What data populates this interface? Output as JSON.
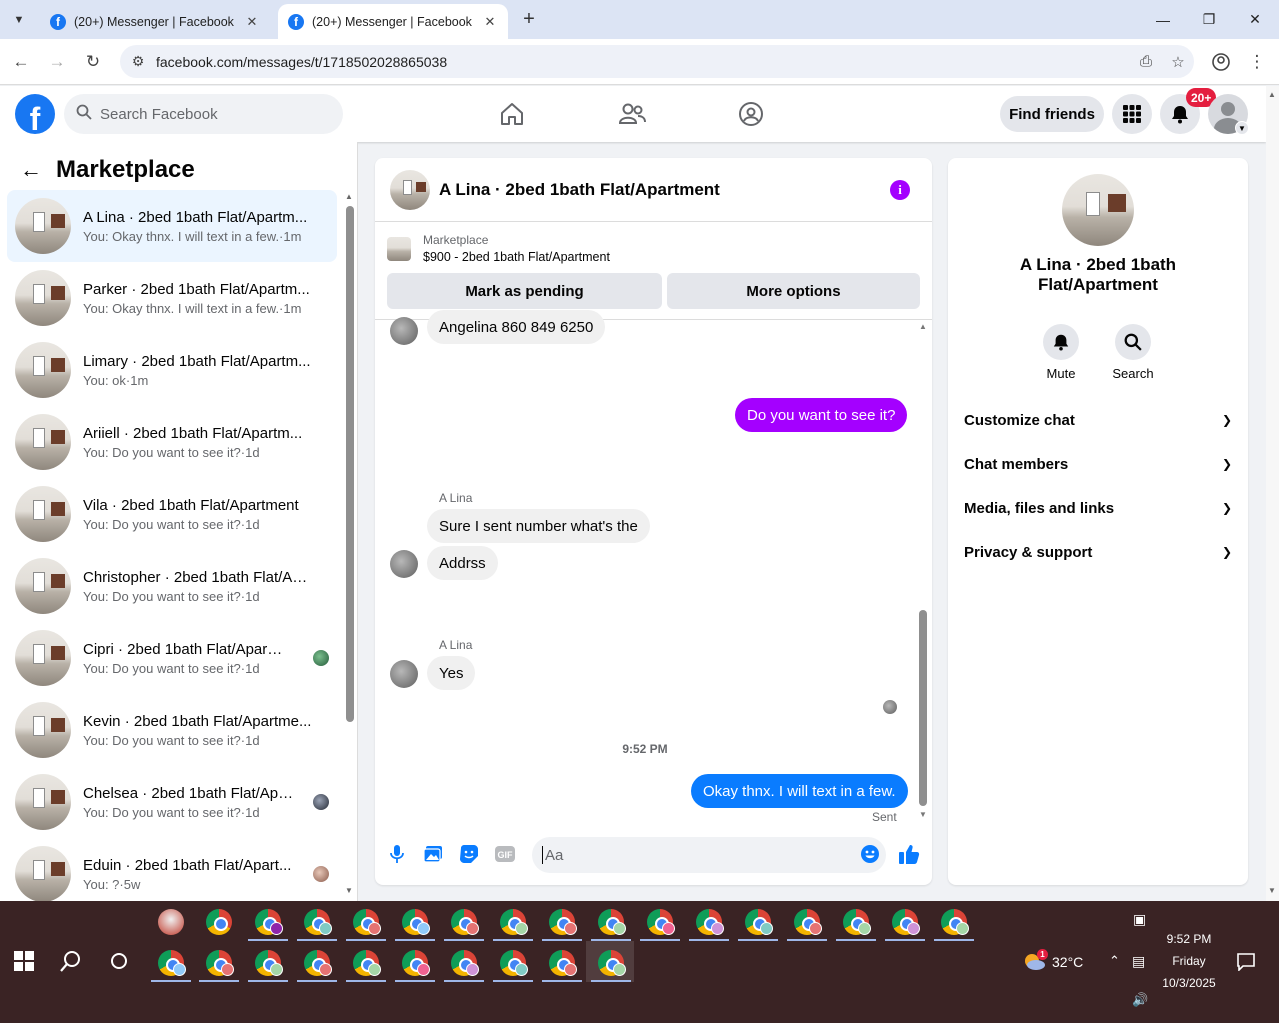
{
  "browser": {
    "tabs": [
      {
        "title": "(20+) Messenger | Facebook",
        "favicon": "facebook-favicon-icon"
      },
      {
        "title": "(20+) Messenger | Facebook",
        "favicon": "facebook-favicon-icon"
      }
    ],
    "url": "facebook.com/messages/t/1718502028865038"
  },
  "header": {
    "search_placeholder": "Search Facebook",
    "find_friends": "Find friends",
    "notif_badge": "20+"
  },
  "sidebar": {
    "title": "Marketplace",
    "conversations": [
      {
        "name": "A Lina · 2bed 1bath Flat/Apartm...",
        "preview": "You: Okay thnx. I will text in a few.·1m"
      },
      {
        "name": "Parker · 2bed 1bath Flat/Apartm...",
        "preview": "You: Okay thnx. I will text in a few.·1m"
      },
      {
        "name": "Limary · 2bed 1bath Flat/Apartm...",
        "preview": "You: ok·1m"
      },
      {
        "name": "Ariiell · 2bed 1bath Flat/Apartm...",
        "preview": "You: Do you want to see it?·1d"
      },
      {
        "name": "Vila · 2bed 1bath Flat/Apartment",
        "preview": "You: Do you want to see it?·1d"
      },
      {
        "name": "Christopher · 2bed 1bath Flat/Ap...",
        "preview": "You: Do you want to see it?·1d"
      },
      {
        "name": "Cipri · 2bed 1bath Flat/Apart...",
        "preview": "You: Do you want to see it?·1d"
      },
      {
        "name": "Kevin · 2bed 1bath Flat/Apartme...",
        "preview": "You: Do you want to see it?·1d"
      },
      {
        "name": "Chelsea · 2bed 1bath Flat/Apa...",
        "preview": "You: Do you want to see it?·1d"
      },
      {
        "name": "Eduin · 2bed 1bath Flat/Apart...",
        "preview": "You: ?·5w"
      }
    ]
  },
  "chat": {
    "title": "A Lina · 2bed 1bath Flat/Apartment",
    "listing_label": "Marketplace",
    "listing_title": "$900 - 2bed 1bath Flat/Apartment",
    "mark_pending": "Mark as pending",
    "more_options": "More options",
    "messages": {
      "m1": "Angelina 860 849 6250",
      "m2": "Do you want to see it?",
      "sender1": "A Lina",
      "m3": "Sure I sent number what's the",
      "m4": "Addrss",
      "sender2": "A Lina",
      "m5": "Yes",
      "time": "9:52 PM",
      "m6": "Okay thnx. I will text in a few.",
      "status": "Sent"
    },
    "composer_placeholder": "Aa"
  },
  "info_panel": {
    "name": "A Lina · 2bed 1bath Flat/Apartment",
    "mute": "Mute",
    "search": "Search",
    "sections": [
      "Customize chat",
      "Chat members",
      "Media, files and links",
      "Privacy & support"
    ]
  },
  "taskbar": {
    "temperature": "32°C",
    "weather_badge": "1",
    "time": "9:52 PM",
    "day": "Friday",
    "date": "10/3/2025"
  },
  "colors": {
    "fb_blue": "#1877f2",
    "messenger_purple": "#a400ff",
    "bubble_blue": "#0a7cff",
    "notif_red": "#e41e3f"
  }
}
